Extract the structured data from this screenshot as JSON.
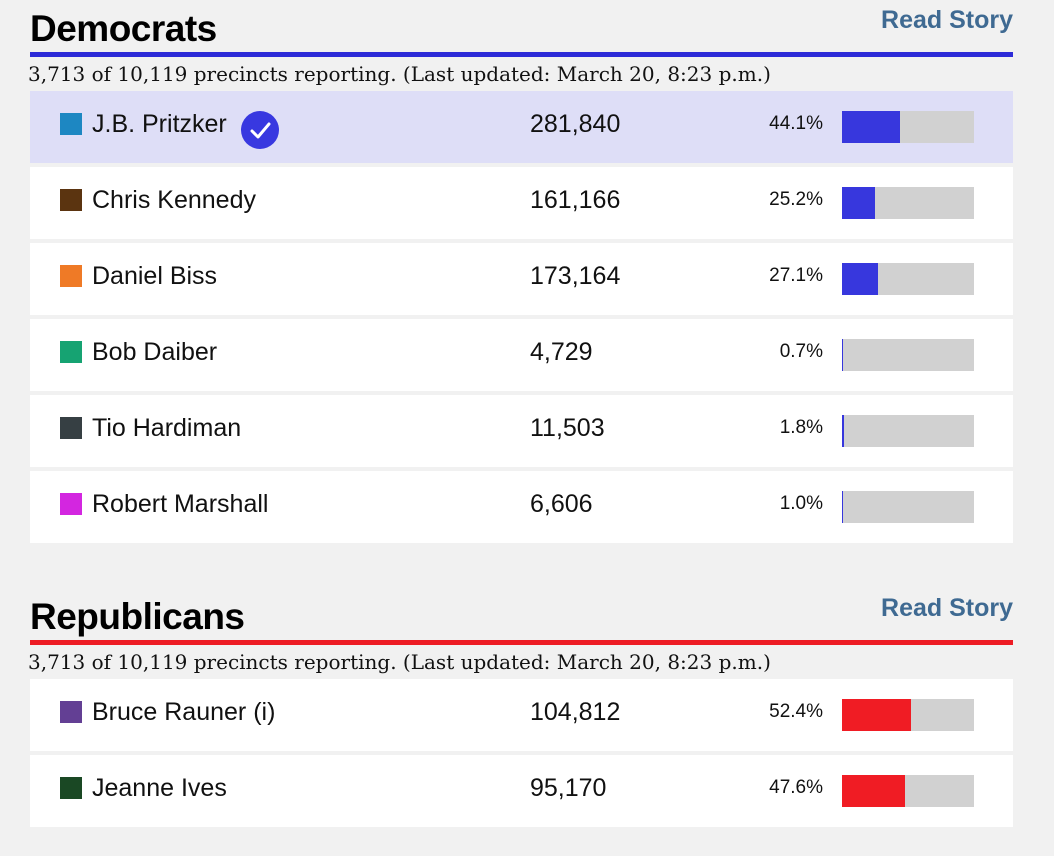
{
  "sections": [
    {
      "id": "dem",
      "title": "Democrats",
      "read_story": "Read Story",
      "subtitle": "3,713 of 10,119 precincts reporting. (Last updated: March 20, 8:23 p.m.)",
      "rule_color": "#2d2bd8",
      "bar_color": "#3737dd",
      "candidates": [
        {
          "name": "J.B. Pritzker",
          "votes": "281,840",
          "pct": "44.1%",
          "share": 0.441,
          "color": "#1d87c2",
          "winner": true,
          "icon": "checkmark-icon"
        },
        {
          "name": "Chris Kennedy",
          "votes": "161,166",
          "pct": "25.2%",
          "share": 0.252,
          "color": "#5b3410",
          "winner": false
        },
        {
          "name": "Daniel Biss",
          "votes": "173,164",
          "pct": "27.1%",
          "share": 0.271,
          "color": "#ef7a26",
          "winner": false
        },
        {
          "name": "Bob Daiber",
          "votes": "4,729",
          "pct": "0.7%",
          "share": 0.007,
          "color": "#16a372",
          "winner": false
        },
        {
          "name": "Tio Hardiman",
          "votes": "11,503",
          "pct": "1.8%",
          "share": 0.018,
          "color": "#363f43",
          "winner": false
        },
        {
          "name": "Robert Marshall",
          "votes": "6,606",
          "pct": "1.0%",
          "share": 0.01,
          "color": "#d326e0",
          "winner": false
        }
      ]
    },
    {
      "id": "rep",
      "title": "Republicans",
      "read_story": "Read Story",
      "subtitle": "3,713 of 10,119 precincts reporting. (Last updated: March 20, 8:23 p.m.)",
      "rule_color": "#ed1c24",
      "bar_color": "#f01c24",
      "candidates": [
        {
          "name": "Bruce Rauner (i)",
          "votes": "104,812",
          "pct": "52.4%",
          "share": 0.524,
          "color": "#633f94",
          "winner": false
        },
        {
          "name": "Jeanne Ives",
          "votes": "95,170",
          "pct": "47.6%",
          "share": 0.476,
          "color": "#1a4824",
          "winner": false
        }
      ]
    }
  ]
}
